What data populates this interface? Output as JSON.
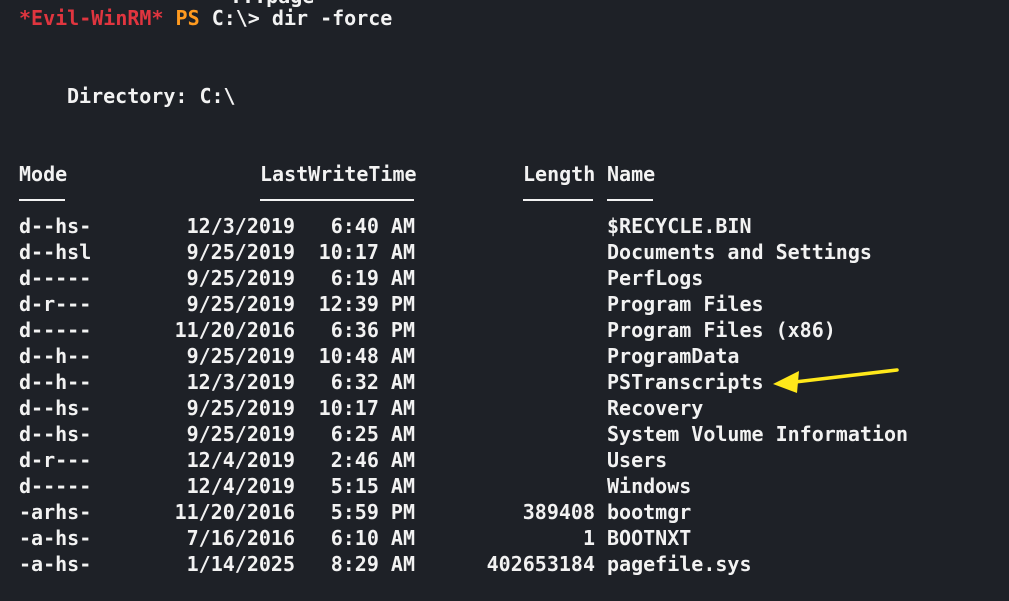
{
  "terminal": {
    "top_clip": "...page",
    "prompt": {
      "evil": "*Evil-WinRM*",
      "ps": "PS",
      "path": "C:\\>",
      "command": "dir -force"
    },
    "directory_label": "Directory: C:\\",
    "headers": {
      "mode": "Mode",
      "lastwritetime": "LastWriteTime",
      "length": "Length",
      "name": "Name"
    },
    "rows": [
      {
        "mode": "d--hs-",
        "date": "12/3/2019",
        "time": "6:40 AM",
        "length": "",
        "name": "$RECYCLE.BIN"
      },
      {
        "mode": "d--hsl",
        "date": "9/25/2019",
        "time": "10:17 AM",
        "length": "",
        "name": "Documents and Settings"
      },
      {
        "mode": "d-----",
        "date": "9/25/2019",
        "time": "6:19 AM",
        "length": "",
        "name": "PerfLogs"
      },
      {
        "mode": "d-r---",
        "date": "9/25/2019",
        "time": "12:39 PM",
        "length": "",
        "name": "Program Files"
      },
      {
        "mode": "d-----",
        "date": "11/20/2016",
        "time": "6:36 PM",
        "length": "",
        "name": "Program Files (x86)"
      },
      {
        "mode": "d--h--",
        "date": "9/25/2019",
        "time": "10:48 AM",
        "length": "",
        "name": "ProgramData"
      },
      {
        "mode": "d--h--",
        "date": "12/3/2019",
        "time": "6:32 AM",
        "length": "",
        "name": "PSTranscripts"
      },
      {
        "mode": "d--hs-",
        "date": "9/25/2019",
        "time": "10:17 AM",
        "length": "",
        "name": "Recovery"
      },
      {
        "mode": "d--hs-",
        "date": "9/25/2019",
        "time": "6:25 AM",
        "length": "",
        "name": "System Volume Information"
      },
      {
        "mode": "d-r---",
        "date": "12/4/2019",
        "time": "2:46 AM",
        "length": "",
        "name": "Users"
      },
      {
        "mode": "d-----",
        "date": "12/4/2019",
        "time": "5:15 AM",
        "length": "",
        "name": "Windows"
      },
      {
        "mode": "-arhs-",
        "date": "11/20/2016",
        "time": "5:59 PM",
        "length": "389408",
        "name": "bootmgr"
      },
      {
        "mode": "-a-hs-",
        "date": "7/16/2016",
        "time": "6:10 AM",
        "length": "1",
        "name": "BOOTNXT"
      },
      {
        "mode": "-a-hs-",
        "date": "1/14/2025",
        "time": "8:29 AM",
        "length": "402653184",
        "name": "pagefile.sys"
      }
    ],
    "annotation": {
      "arrow_color": "#ffe81a",
      "icon": "arrow-left-icon"
    }
  }
}
